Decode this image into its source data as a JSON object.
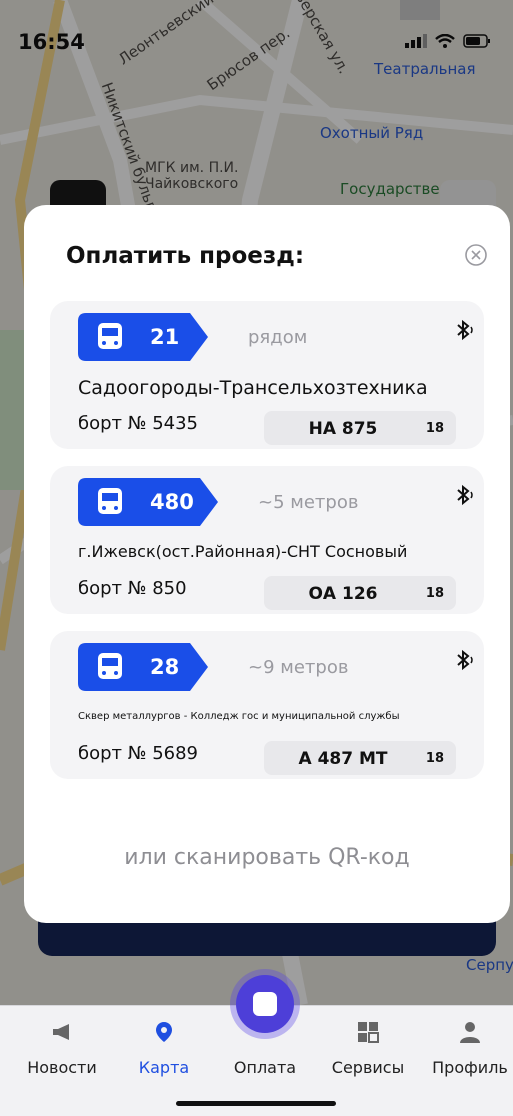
{
  "status": {
    "time": "16:54"
  },
  "map": {
    "labels": [
      "Леонтьевский",
      "Брюсов пер.",
      "Тверская ул.",
      "Театральная",
      "Охотный Ряд",
      "МГК им. П.И. Чайковского",
      "Государстве",
      "Никитский бульв.",
      "Серпу"
    ]
  },
  "modal": {
    "title": "Оплатить проезд:",
    "close_icon": "close-circle-icon",
    "qr_link": "или сканировать QR-код",
    "cards": [
      {
        "route_number": "21",
        "distance": "рядом",
        "route_name": "Садоогороды-Трансельхозтехника",
        "board": "борт № 5435",
        "plate": "НА 875",
        "region": "18",
        "route_font": 20
      },
      {
        "route_number": "480",
        "distance": "~5 метров",
        "route_name": "г.Ижевск(ост.Районная)-СНТ Сосновый",
        "board": "борт № 850",
        "plate": "ОА 126",
        "region": "18",
        "route_font": 17
      },
      {
        "route_number": "28",
        "distance": "~9 метров",
        "route_name": "Сквер металлургов - Колледж гос и муниципальной службы",
        "board": "борт № 5689",
        "plate": "А 487 МТ",
        "region": "18",
        "route_font": 10
      }
    ]
  },
  "tabbar": {
    "items": [
      {
        "label": "Новости",
        "icon": "megaphone-icon",
        "active": false
      },
      {
        "label": "Карта",
        "icon": "map-pin-icon",
        "active": true
      },
      {
        "label": "Оплата",
        "icon": "qr-icon",
        "active": false
      },
      {
        "label": "Сервисы",
        "icon": "grid-icon",
        "active": false
      },
      {
        "label": "Профиль",
        "icon": "person-icon",
        "active": false
      }
    ]
  },
  "colors": {
    "accent": "#1f4fe0",
    "badge_blue": "#1a4ee8",
    "dark_button": "#162657",
    "pay_button": "#4d3fd8"
  }
}
